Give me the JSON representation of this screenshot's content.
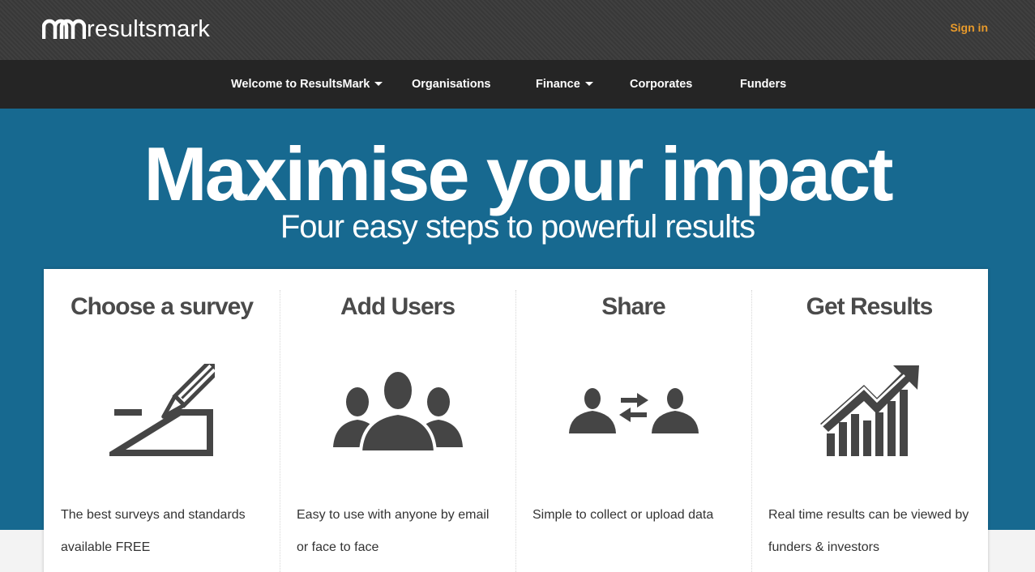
{
  "header": {
    "logo_text": "resultsmark",
    "signin_label": "Sign in"
  },
  "nav": {
    "items": [
      {
        "label": "Welcome to ResultsMark",
        "has_dropdown": true
      },
      {
        "label": "Organisations",
        "has_dropdown": false
      },
      {
        "label": "Finance",
        "has_dropdown": true
      },
      {
        "label": "Corporates",
        "has_dropdown": false
      },
      {
        "label": "Funders",
        "has_dropdown": false
      }
    ]
  },
  "hero": {
    "title": "Maximise your impact",
    "subtitle": "Four easy steps to powerful results"
  },
  "steps": [
    {
      "title": "Choose a survey",
      "icon": "pencil-survey-icon",
      "desc_line1": "The best surveys and standards",
      "desc_line2": "available FREE"
    },
    {
      "title": "Add Users",
      "icon": "users-group-icon",
      "desc_line1": "Easy to use with anyone by email",
      "desc_line2": "or face to face"
    },
    {
      "title": "Share",
      "icon": "share-exchange-icon",
      "desc_line1": "Simple to collect or upload data",
      "desc_line2": ""
    },
    {
      "title": "Get Results",
      "icon": "growth-chart-icon",
      "desc_line1": "Real time results can be viewed by",
      "desc_line2": "funders & investors"
    }
  ],
  "colors": {
    "topbar": "#3a3a3a",
    "navbar": "#252525",
    "hero": "#176990",
    "accent": "#e89a2b",
    "icon": "#454545"
  }
}
